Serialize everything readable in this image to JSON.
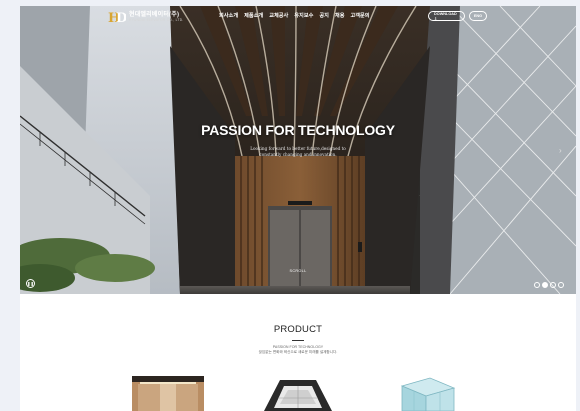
{
  "header": {
    "logo_ko": "현대엘리베이터(주)",
    "logo_en": "HYUNDAI ELEVATOR CO., LTD.",
    "nav": [
      "회사소개",
      "제품소개",
      "교체공사",
      "유지보수",
      "공지",
      "채용",
      "고객문의"
    ],
    "download_label": "DOWNLOAD ⇩",
    "eng_label": "ENG"
  },
  "hero": {
    "title": "PASSION FOR TECHNOLOGY",
    "subtitle_line1": "Looking forward to better future,designed to",
    "subtitle_line2": "constantly changing and innovation.",
    "scroll_label": "SCROLL",
    "slide_count": 4,
    "active_slide": 2
  },
  "product": {
    "title": "PRODUCT",
    "subtitle_line1": "PASSION FOR TECHNOLOGY",
    "subtitle_line2": "끊임없는 변화와 혁신으로 새로운 미래를 설계합니다."
  }
}
